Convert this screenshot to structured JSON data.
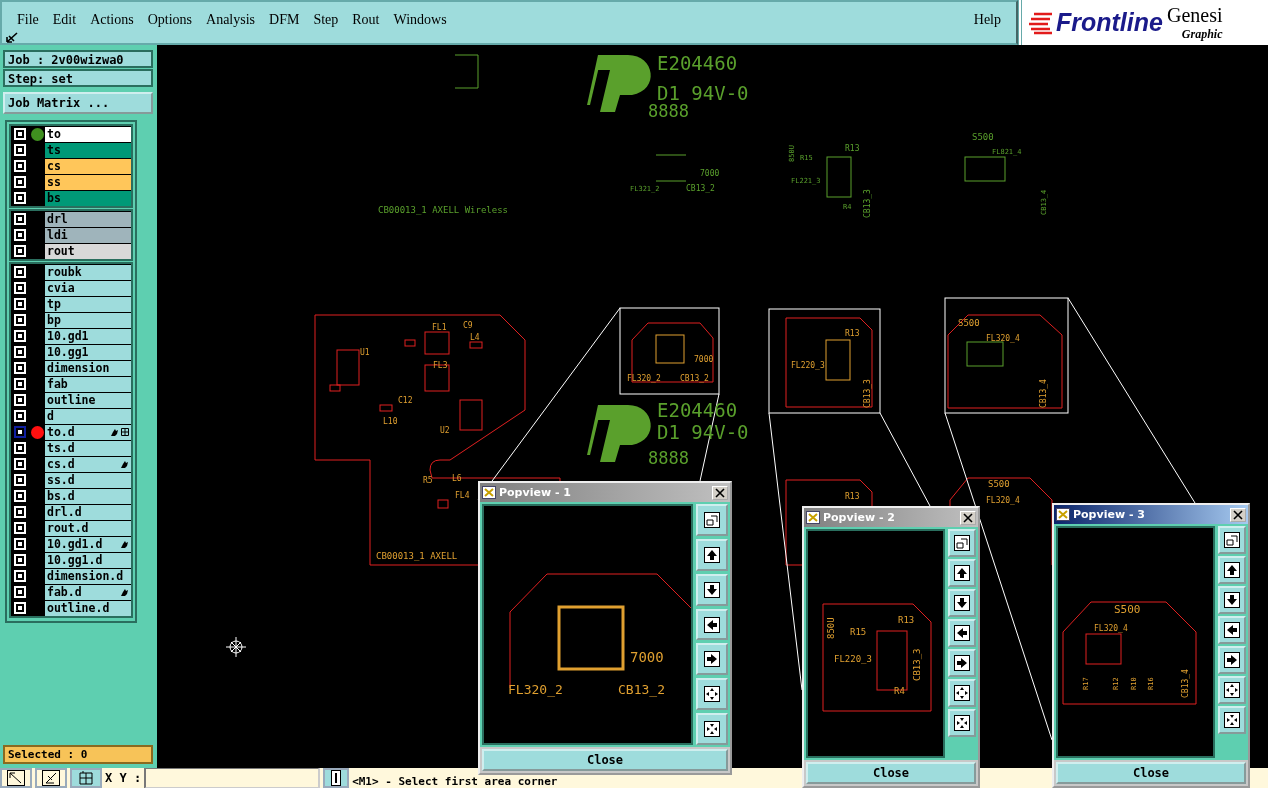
{
  "menu": [
    "File",
    "Edit",
    "Actions",
    "Options",
    "Analysis",
    "DFM",
    "Step",
    "Rout",
    "Windows"
  ],
  "help": "Help",
  "logo": {
    "brand": "Frontline",
    "product": "Genesi",
    "subtitle": "Graphic"
  },
  "job": "Job : 2v00wizwa0",
  "step": "Step: set",
  "job_matrix_button": "Job Matrix ...",
  "layer_groups": [
    [
      {
        "name": "to",
        "color": "#ffffff",
        "selected": false,
        "displayed": true,
        "work_layer": false,
        "hand": false,
        "grid": false
      },
      {
        "name": "ts",
        "color": "#009977",
        "selected": false,
        "displayed": false,
        "work_layer": false,
        "hand": false,
        "grid": false
      },
      {
        "name": "cs",
        "color": "#ffc65a",
        "selected": false,
        "displayed": false,
        "work_layer": false,
        "hand": false,
        "grid": false
      },
      {
        "name": "ss",
        "color": "#ffc65a",
        "selected": false,
        "displayed": false,
        "work_layer": false,
        "hand": false,
        "grid": false
      },
      {
        "name": "bs",
        "color": "#009977",
        "selected": false,
        "displayed": false,
        "work_layer": false,
        "hand": false,
        "grid": false
      }
    ],
    [
      {
        "name": "drl",
        "color": "#9fb4bb",
        "selected": false,
        "displayed": false,
        "work_layer": false,
        "hand": false,
        "grid": false
      },
      {
        "name": "ldi",
        "color": "#9fb4bb",
        "selected": false,
        "displayed": false,
        "work_layer": false,
        "hand": false,
        "grid": false
      },
      {
        "name": "rout",
        "color": "#d8d8d8",
        "selected": false,
        "displayed": false,
        "work_layer": false,
        "hand": false,
        "grid": false
      }
    ],
    [
      {
        "name": "roubk",
        "color": "#9edcdc",
        "selected": false,
        "displayed": false,
        "work_layer": false,
        "hand": false,
        "grid": false
      },
      {
        "name": "cvia",
        "color": "#9edcdc",
        "selected": false,
        "displayed": false,
        "work_layer": false,
        "hand": false,
        "grid": false
      },
      {
        "name": "tp",
        "color": "#9edcdc",
        "selected": false,
        "displayed": false,
        "work_layer": false,
        "hand": false,
        "grid": false
      },
      {
        "name": "bp",
        "color": "#9edcdc",
        "selected": false,
        "displayed": false,
        "work_layer": false,
        "hand": false,
        "grid": false
      },
      {
        "name": "10.gd1",
        "color": "#9edcdc",
        "selected": false,
        "displayed": false,
        "work_layer": false,
        "hand": false,
        "grid": false
      },
      {
        "name": "10.gg1",
        "color": "#9edcdc",
        "selected": false,
        "displayed": false,
        "work_layer": false,
        "hand": false,
        "grid": false
      },
      {
        "name": "dimension",
        "color": "#9edcdc",
        "selected": false,
        "displayed": false,
        "work_layer": false,
        "hand": false,
        "grid": false
      },
      {
        "name": "fab",
        "color": "#9edcdc",
        "selected": false,
        "displayed": false,
        "work_layer": false,
        "hand": false,
        "grid": false
      },
      {
        "name": "outline",
        "color": "#9edcdc",
        "selected": false,
        "displayed": false,
        "work_layer": false,
        "hand": false,
        "grid": false
      },
      {
        "name": "d",
        "color": "#9edcdc",
        "selected": false,
        "displayed": false,
        "work_layer": false,
        "hand": false,
        "grid": false
      },
      {
        "name": "to.d",
        "color": "#9edcdc",
        "selected": true,
        "displayed": false,
        "work_layer": true,
        "hand": true,
        "grid": true
      },
      {
        "name": "ts.d",
        "color": "#9edcdc",
        "selected": false,
        "displayed": false,
        "work_layer": false,
        "hand": false,
        "grid": false
      },
      {
        "name": "cs.d",
        "color": "#9edcdc",
        "selected": false,
        "displayed": false,
        "work_layer": false,
        "hand": true,
        "grid": false
      },
      {
        "name": "ss.d",
        "color": "#9edcdc",
        "selected": false,
        "displayed": false,
        "work_layer": false,
        "hand": false,
        "grid": false
      },
      {
        "name": "bs.d",
        "color": "#9edcdc",
        "selected": false,
        "displayed": false,
        "work_layer": false,
        "hand": false,
        "grid": false
      },
      {
        "name": "drl.d",
        "color": "#9edcdc",
        "selected": false,
        "displayed": false,
        "work_layer": false,
        "hand": false,
        "grid": false
      },
      {
        "name": "rout.d",
        "color": "#9edcdc",
        "selected": false,
        "displayed": false,
        "work_layer": false,
        "hand": false,
        "grid": false
      },
      {
        "name": "10.gd1.d",
        "color": "#9edcdc",
        "selected": false,
        "displayed": false,
        "work_layer": false,
        "hand": true,
        "grid": false
      },
      {
        "name": "10.gg1.d",
        "color": "#9edcdc",
        "selected": false,
        "displayed": false,
        "work_layer": false,
        "hand": false,
        "grid": false
      },
      {
        "name": "dimension.d",
        "color": "#9edcdc",
        "selected": false,
        "displayed": false,
        "work_layer": false,
        "hand": false,
        "grid": false
      },
      {
        "name": "fab.d",
        "color": "#9edcdc",
        "selected": false,
        "displayed": false,
        "work_layer": false,
        "hand": true,
        "grid": false
      },
      {
        "name": "outline.d",
        "color": "#9edcdc",
        "selected": false,
        "displayed": false,
        "work_layer": false,
        "hand": false,
        "grid": false
      }
    ]
  ],
  "selected_count": "Selected : 0",
  "board_labels": [
    "E204460",
    "D1 94V-0",
    "8888",
    "CB00013_1  AXELL Wireless",
    "FL321_2",
    "7000",
    "CB13_2",
    "850U",
    "R15",
    "R13",
    "FL221_3",
    "R4",
    "CB13_3",
    "S500",
    "FL821_4",
    "CB13_4",
    "E204460",
    "D1 94V-0",
    "8888",
    "CB00013_1  AXELL",
    "FL320_2",
    "7000",
    "CB13_2",
    "R13",
    "FL220_3",
    "CB13_3",
    "S500",
    "FL320_4",
    "CB13_4",
    "R13",
    "S500",
    "FL320_4",
    "FL1",
    "C9",
    "L4",
    "U1",
    "FL3",
    "U2",
    "L10",
    "C12",
    "R5",
    "L6",
    "FL4"
  ],
  "popviews": [
    {
      "title": "Popview - 1",
      "active": false,
      "labels": [
        "FL320_2",
        "CB13_2",
        "7000"
      ],
      "close": "Close"
    },
    {
      "title": "Popview - 2",
      "active": false,
      "labels": [
        "850U",
        "R15",
        "R13",
        "FL220_3",
        "CB13_3",
        "R4"
      ],
      "close": "Close"
    },
    {
      "title": "Popview - 3",
      "active": true,
      "labels": [
        "S500",
        "FL320_4",
        "R17",
        "R12",
        "R10",
        "R16",
        "CB13_4"
      ],
      "close": "Close"
    }
  ],
  "xy_label": "X Y :",
  "status_message": "<M1> - Select first area corner"
}
